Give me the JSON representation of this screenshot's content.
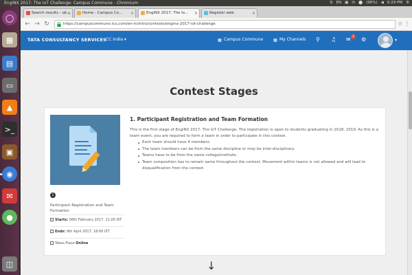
{
  "system": {
    "window_title": "EngiNX 2017: The IoT Challenge: Campus Commune - Chromium",
    "indicators": [
      "⇅",
      "EN",
      "▣",
      "✉",
      "⬤",
      "(96%)",
      "◀",
      "6:29 PM",
      "⚙"
    ]
  },
  "browser": {
    "tabs": [
      {
        "label": "Search results - ob...",
        "color": "#d9534f"
      },
      {
        "label": "Home - Campus Co...",
        "color": "#f0ad4e"
      },
      {
        "label": "EngiNX 2017: The Io...",
        "color": "#f0ad4e"
      },
      {
        "label": "Register web",
        "color": "#5bc0de"
      }
    ],
    "url": "https://campuscommune.tcs.com/en-in/intro/contests/enginx-2017-iot-challenge"
  },
  "site": {
    "brand": "TATA CONSULTANCY SERVICES",
    "region": "CC India ▾",
    "nav": [
      {
        "label": "Campus Commune"
      },
      {
        "label": "My Channels"
      }
    ],
    "notification_count": "1"
  },
  "page": {
    "heading": "Contest Stages",
    "stage": {
      "number": "1",
      "title": "1. Participant Registration and Team Formation",
      "description": "This is the first stage of EngiNX 2017: The IoT Challenge. The registration is open to students graduating in 2018, 2019. As this is a team event, you are required to form a team in order to participate in this contest.",
      "rules": [
        "Each team should have 4 members.",
        "The team members can be from the same discipline or may be inter-disciplinary.",
        "Teams have to be from the same college/institute.",
        "Team composition has to remain same throughout the contest. Movement within teams is not allowed and will lead to disqualification from the contest."
      ],
      "side_title": "Participant Registration and Team Formation",
      "starts_label": "Starts:",
      "starts_value": "06th February 2017, 11:00 IST",
      "ends_label": "Ends:",
      "ends_value": "9th April 2017, 18:00 IST",
      "place_label": "Takes Place",
      "place_value": "Online"
    }
  }
}
